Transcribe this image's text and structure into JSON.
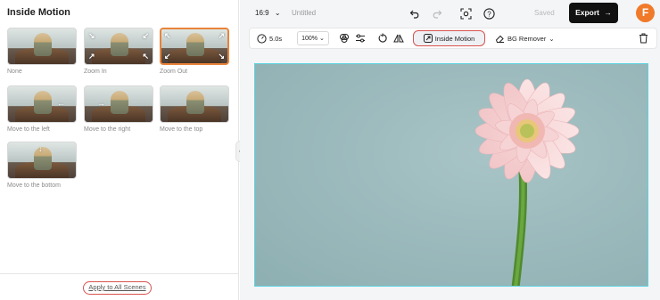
{
  "left_panel": {
    "title": "Inside Motion",
    "effects": [
      {
        "label": "None",
        "selected": false
      },
      {
        "label": "Zoom In",
        "selected": false
      },
      {
        "label": "Zoom Out",
        "selected": true
      },
      {
        "label": "Move to the left",
        "selected": false
      },
      {
        "label": "Move to the right",
        "selected": false
      },
      {
        "label": "Move to the top",
        "selected": false
      },
      {
        "label": "Move to the bottom",
        "selected": false
      }
    ],
    "apply_all_label": "Apply to All Scenes"
  },
  "topbar": {
    "aspect_ratio": "16:9",
    "document_title": "Untitled",
    "saved_label": "Saved",
    "export_label": "Export",
    "avatar_letter": "F"
  },
  "toolbar": {
    "duration": "5.0s",
    "zoom": "100%",
    "inside_motion_label": "Inside Motion",
    "bg_remover_label": "BG Remover"
  },
  "colors": {
    "accent": "#e8833a",
    "highlight_ring": "#d9534f",
    "canvas_border": "#5ed3e0",
    "export_bg": "#111111",
    "canvas_bg": "#9bb9bc"
  },
  "icons": [
    "undo-icon",
    "redo-icon",
    "screen-record-icon",
    "help-icon",
    "timer-icon",
    "filters-icon",
    "adjust-icon",
    "rotate-icon",
    "flip-icon",
    "motion-icon",
    "eraser-icon",
    "trash-icon"
  ]
}
